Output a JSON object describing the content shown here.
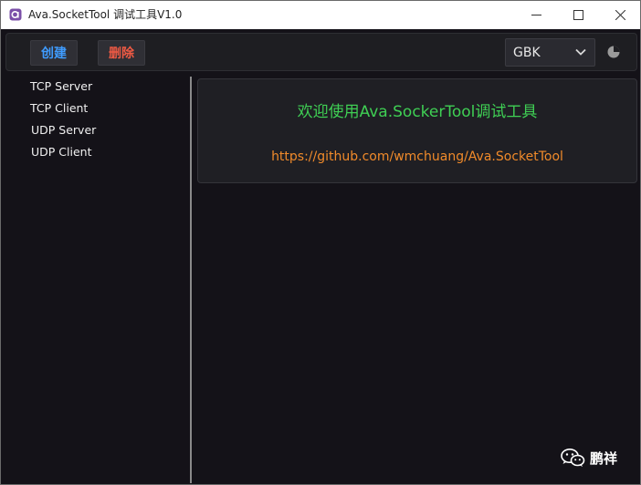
{
  "window": {
    "title": "Ava.SocketTool 调试工具V1.0",
    "controls": {
      "minimize": "minimize-icon",
      "maximize": "maximize-icon",
      "close": "close-icon"
    }
  },
  "toolbar": {
    "create_label": "创建",
    "delete_label": "删除",
    "encoding": {
      "selected": "GBK"
    },
    "theme_icon": "theme-toggle-icon"
  },
  "sidebar": {
    "items": [
      {
        "label": "TCP Server"
      },
      {
        "label": "TCP Client"
      },
      {
        "label": "UDP Server"
      },
      {
        "label": "UDP Client"
      }
    ]
  },
  "welcome": {
    "heading": "欢迎使用Ava.SockerTool调试工具",
    "link": "https://github.com/wmchuang/Ava.SocketTool"
  },
  "watermark": {
    "text": "鹏祥"
  },
  "colors": {
    "background": "#141218",
    "create_button_text": "#3f9cff",
    "delete_button_text": "#ef5a44",
    "welcome_text": "#3fcf54",
    "link_text": "#f08a2a"
  }
}
